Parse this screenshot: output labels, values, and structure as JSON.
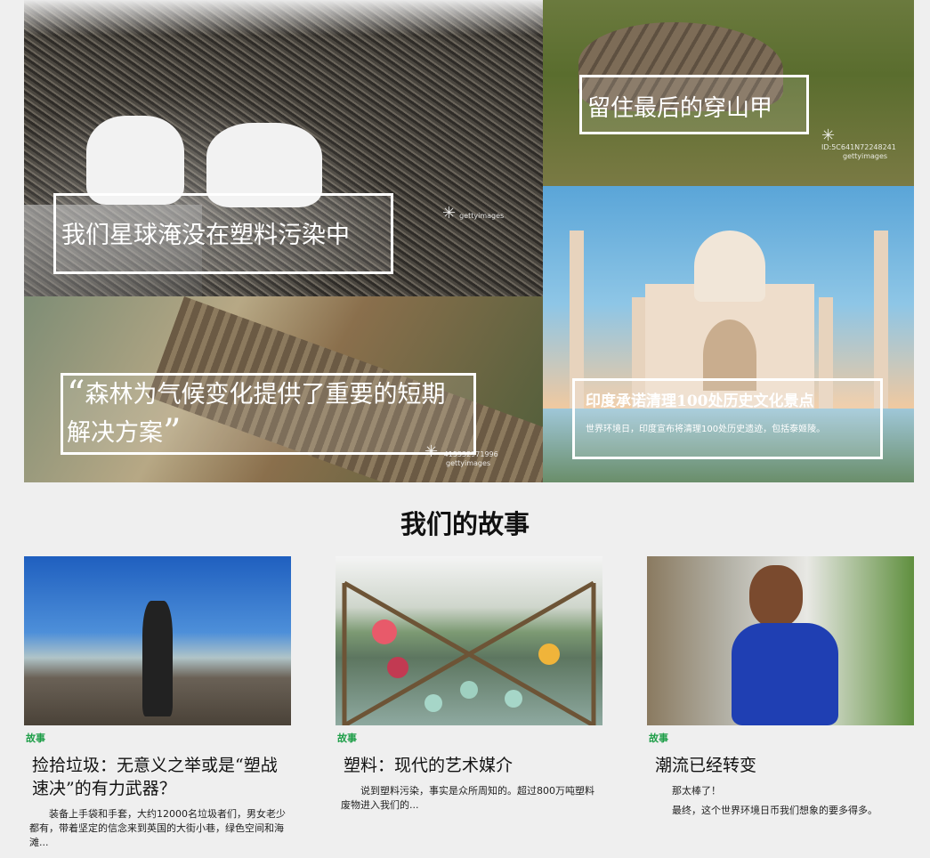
{
  "hero": {
    "tiles": [
      {
        "caption": "我们星球淹没在塑料污染中",
        "credit": "gettyimages"
      },
      {
        "caption": "留住最后的穿山甲",
        "credit_id": "ID:5C641N72248241",
        "credit": "gettyimages"
      },
      {
        "quote_open": "“",
        "caption": "森林为气候变化提供了重要的短期解决方案",
        "quote_close": "”",
        "credit_id": "415332971996",
        "credit": "gettyimages"
      },
      {
        "caption": "印度承诺清理100处历史文化景点",
        "subtitle": "世界环境日，印度宣布将清理100处历史遗迹，包括泰姬陵。"
      }
    ]
  },
  "section": {
    "title": "我们的故事"
  },
  "cards": [
    {
      "tag": "故事",
      "title": "捡拾垃圾：无意义之举或是“塑战速决”的有力武器？",
      "desc": "装备上手袋和手套，大约12000名垃圾者们，男女老少都有，带着坚定的信念来到英国的大街小巷，绿色空间和海滩..."
    },
    {
      "tag": "故事",
      "title": "塑料：现代的艺术媒介",
      "desc": "说到塑料污染，事实是众所周知的。超过800万吨塑料废物进入我们的..."
    },
    {
      "tag": "故事",
      "title": "潮流已经转变",
      "desc": "那太棒了！",
      "desc2": "最终，这个世界环境日币我们想象的要多得多。"
    }
  ],
  "colors": {
    "accent_green": "#1e9e48",
    "background": "#efefef"
  }
}
